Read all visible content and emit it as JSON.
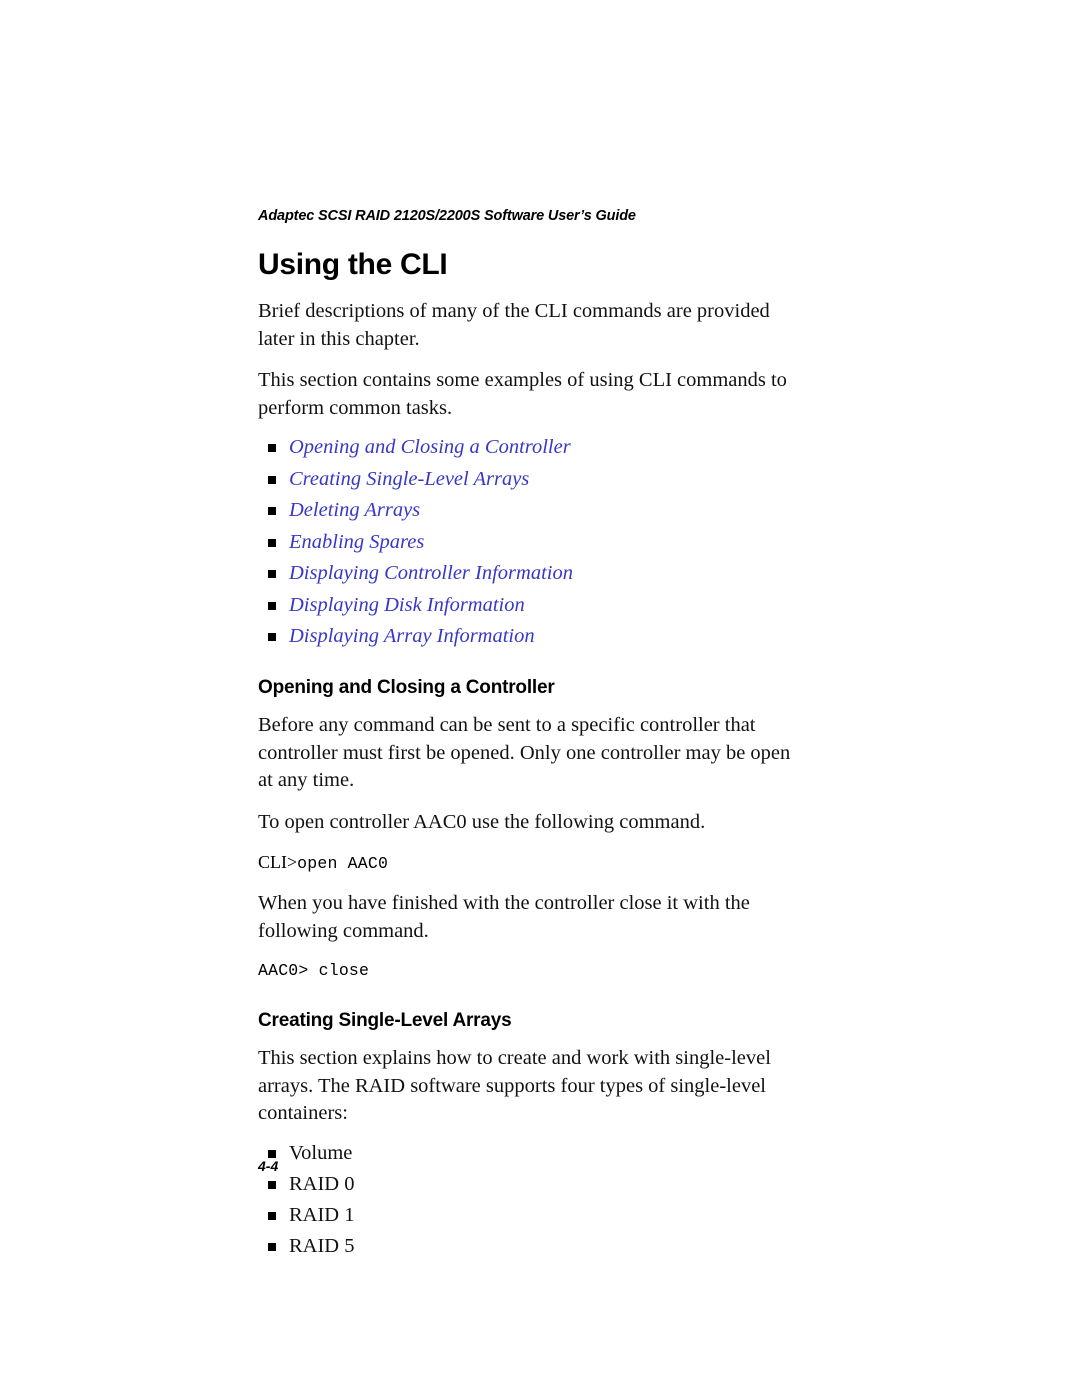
{
  "document": {
    "running_header": "Adaptec SCSI RAID 2120S/2200S Software User’s Guide",
    "page_number": "4-4",
    "link_color": "#3737c8",
    "text_color": "#111111"
  },
  "chapter": {
    "title": "Using the CLI",
    "intro_paragraphs": [
      "Brief descriptions of many of the CLI commands are provided later in this chapter.",
      "This section contains some examples of using CLI commands to perform common tasks."
    ],
    "links": [
      {
        "label": "Opening and Closing a Controller",
        "bullet": "square-bullet-icon"
      },
      {
        "label": "Creating Single-Level Arrays",
        "bullet": "square-bullet-icon"
      },
      {
        "label": "Deleting Arrays",
        "bullet": "square-bullet-icon"
      },
      {
        "label": "Enabling Spares",
        "bullet": "square-bullet-icon"
      },
      {
        "label": "Displaying Controller Information",
        "bullet": "square-bullet-icon"
      },
      {
        "label": "Displaying Disk Information",
        "bullet": "square-bullet-icon"
      },
      {
        "label": "Displaying Array Information",
        "bullet": "square-bullet-icon"
      }
    ]
  },
  "section_open_close": {
    "heading": "Opening and Closing a Controller",
    "paragraph_1": "Before any command can be sent to a specific controller that controller must first be opened. Only one controller may be open at any time.",
    "paragraph_2": "To open controller AAC0 use the following command.",
    "command_1_prompt": "CLI>",
    "command_1_text": "open AAC0",
    "paragraph_3": "When you have finished with the controller close it with the following command.",
    "command_2_text": "AAC0> close"
  },
  "section_create_arrays": {
    "heading": "Creating Single-Level Arrays",
    "paragraph_1": "This section explains how to create and work with single-level arrays. The RAID software supports four types of single-level containers:",
    "container_types": [
      {
        "label": "Volume"
      },
      {
        "label": "RAID 0"
      },
      {
        "label": "RAID 1"
      },
      {
        "label": "RAID 5"
      }
    ]
  }
}
